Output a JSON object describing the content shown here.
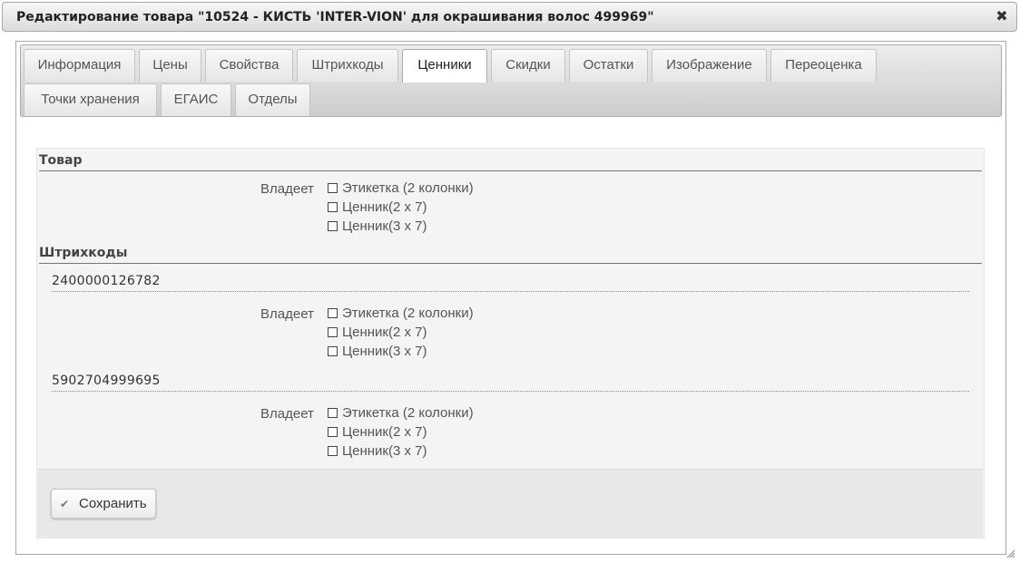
{
  "dialog": {
    "title": "Редактирование товара \"10524 - КИСТЬ 'INTER-VION' для окрашивания волос 499969\"",
    "close_glyph": "✖"
  },
  "tabs": [
    {
      "label": "Информация",
      "active": false
    },
    {
      "label": "Цены",
      "active": false
    },
    {
      "label": "Свойства",
      "active": false
    },
    {
      "label": "Штрихкоды",
      "active": false
    },
    {
      "label": "Ценники",
      "active": true
    },
    {
      "label": "Скидки",
      "active": false
    },
    {
      "label": "Остатки",
      "active": false
    },
    {
      "label": "Изображение",
      "active": false
    },
    {
      "label": "Переоценка",
      "active": false
    },
    {
      "label": "Точки хранения",
      "active": false
    },
    {
      "label": "ЕГАИС",
      "active": false
    },
    {
      "label": "Отделы",
      "active": false
    }
  ],
  "product_section": {
    "title": "Товар",
    "owner_label": "Владеет",
    "options": [
      {
        "label": "Этикетка (2 колонки)",
        "checked": false
      },
      {
        "label": "Ценник(2 x 7)",
        "checked": false
      },
      {
        "label": "Ценник(3 x 7)",
        "checked": false
      }
    ]
  },
  "barcodes_section": {
    "title": "Штрихкоды",
    "barcodes": [
      {
        "code": "2400000126782",
        "owner_label": "Владеет",
        "options": [
          {
            "label": "Этикетка (2 колонки)",
            "checked": false
          },
          {
            "label": "Ценник(2 x 7)",
            "checked": false
          },
          {
            "label": "Ценник(3 x 7)",
            "checked": false
          }
        ]
      },
      {
        "code": "5902704999695",
        "owner_label": "Владеет",
        "options": [
          {
            "label": "Этикетка (2 колонки)",
            "checked": false
          },
          {
            "label": "Ценник(2 x 7)",
            "checked": false
          },
          {
            "label": "Ценник(3 x 7)",
            "checked": false
          }
        ]
      }
    ]
  },
  "footer": {
    "save_label": "Сохранить",
    "check_glyph": "✔"
  }
}
